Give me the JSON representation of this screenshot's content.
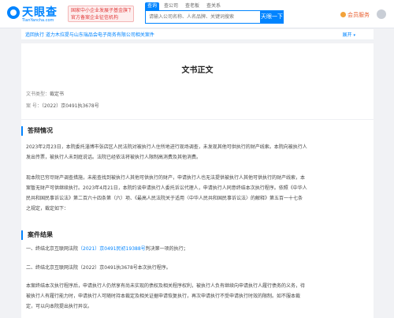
{
  "header": {
    "logo_name": "天眼查",
    "logo_url": "TianYancha.com",
    "gov_badge_line1": "国家中小企业发展子基金旗下",
    "gov_badge_line2": "官方备案企业征信机构",
    "search_tabs": [
      "查询",
      "查公司",
      "查老板",
      "查关系"
    ],
    "search_placeholder": "请输入公司名称、人名品牌、关键词搜索",
    "search_button": "天眼一下",
    "vip_label": "会员服务"
  },
  "associated": {
    "text": "追回执行 道力木拉提与山东瑞品会电子商务有限公司相关案件",
    "expand_label": "展开"
  },
  "document": {
    "title": "文书正文",
    "type_key": "文书类型：",
    "type_value": "裁定书",
    "case_key": "案      号：",
    "case_value": "（2022）京0491执3678号"
  },
  "sections": {
    "s1_title": "答辩情况",
    "s1_p1_line1": "2023年2月23日，本院委托淄博市张店区人民法院对被执行人住所地进行现场调查，未发现其他可供执行的财产线索。本院向被执行人",
    "s1_p1_line2": "发出传票，被执行人未到庭说话。法院已经依法将被执行人限制高消费及其他消费。",
    "s1_p2_line1": "现本院已穷尽财产调查措施，未能查找到被执行人其他可供执行的财产，申请执行人也无法提供被执行人其他可供执行的财产线索，本",
    "s1_p2_line2": "案暂无财产可供继续执行。2023年4月21日，本院约谈申请执行人委托诉讼代理人，申请执行人同意终结本次执行程序。依照《中华人",
    "s1_p2_line3": "民共和国民事诉讼法》第二百六十四条第（六）项、《最高人民法院关于适用〈中华人民共和国民事诉讼法〉的解释》第五百一十七条",
    "s1_p2_line4": "之规定，裁定如下：",
    "s2_title": "案件结果",
    "s2_item1_prefix": "一、终结北京互联网法院",
    "s2_item1_link": "（2021）京0491民初19388号",
    "s2_item1_suffix": "判决第一项的执行；",
    "s2_item2": "二、终结北京互联网法院（2022）京0491执3678号本次执行程序。",
    "s2_p_line1": "本案终结本次执行程序后，申请执行人仍然享有尚未实现的债权及相关程序权利，被执行人负有继续向申请执行人履行债务的义务，待",
    "s2_p_line2": "被执行人有履行能力时，申请执行人可随时持本裁定及相关证据申请恢复执行，再次申请执行不受申请执行时效的限制。如不服本裁",
    "s2_p_line3": "定，可以向本院提出执行异议。"
  },
  "colors": {
    "accent": "#0084ff",
    "vip": "#e85f2f",
    "badge": "#e23b3b"
  }
}
